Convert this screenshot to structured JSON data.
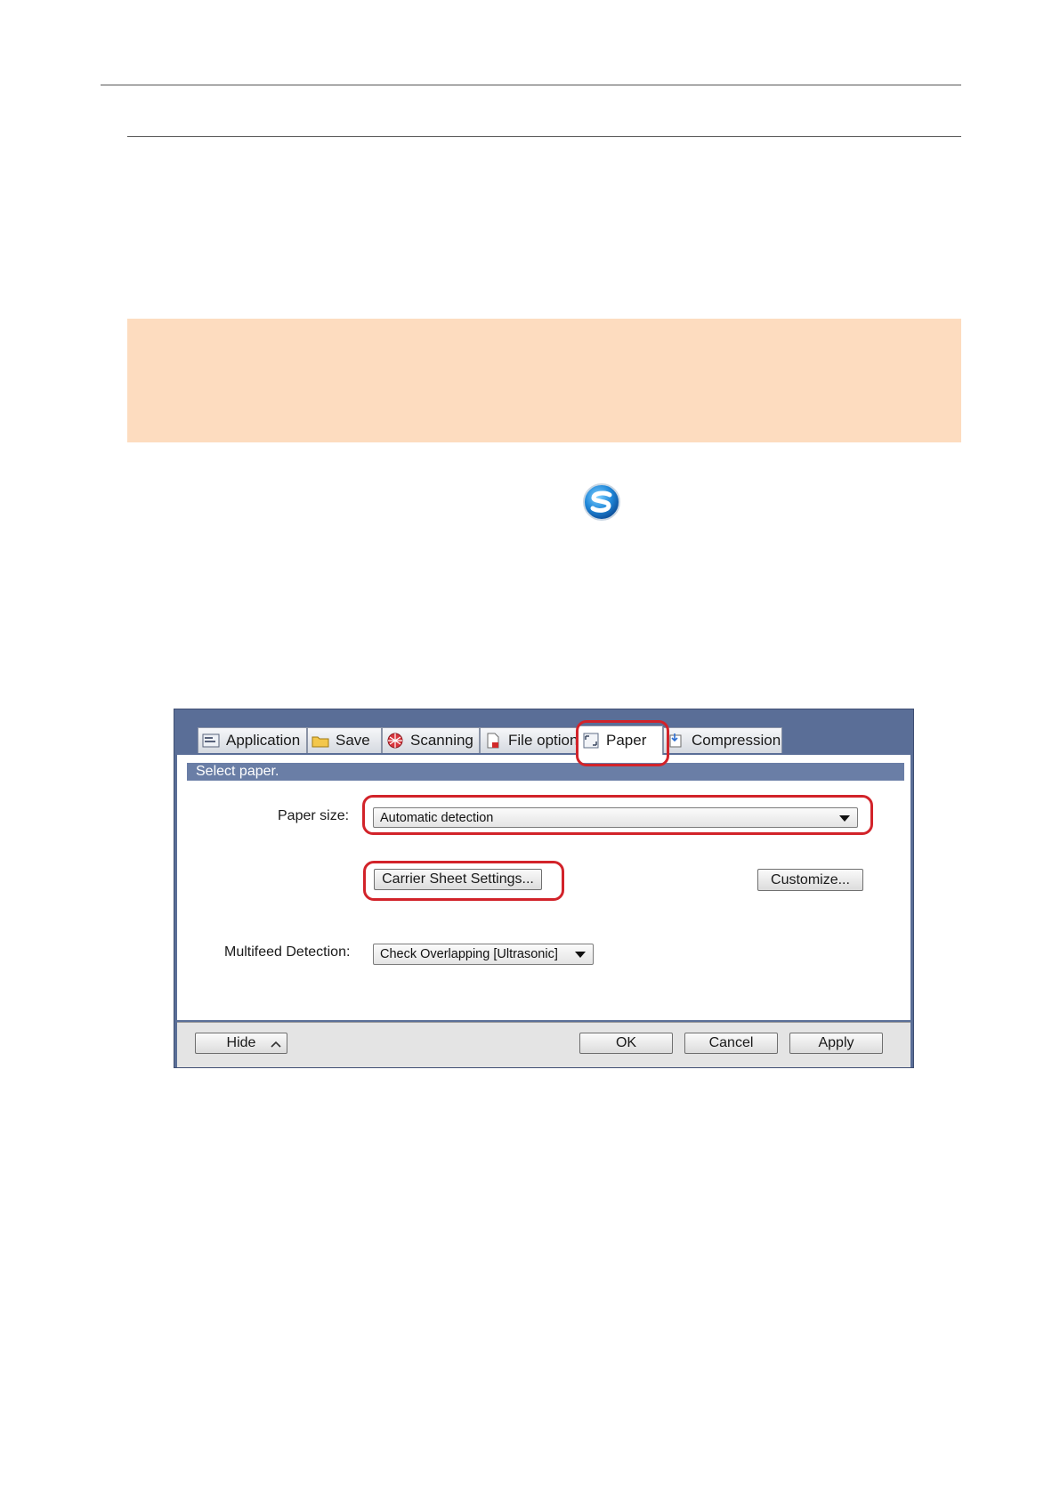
{
  "dialog": {
    "tabs": [
      {
        "label": "Application",
        "icon": "application-icon"
      },
      {
        "label": "Save",
        "icon": "folder-icon"
      },
      {
        "label": "Scanning",
        "icon": "scanning-icon"
      },
      {
        "label": "File option",
        "icon": "file-option-icon"
      },
      {
        "label": "Paper",
        "icon": "paper-icon",
        "active": true
      },
      {
        "label": "Compression",
        "icon": "compression-icon"
      }
    ],
    "section_title": "Select paper.",
    "paper_size_label": "Paper size:",
    "paper_size_value": "Automatic detection",
    "carrier_button": "Carrier Sheet Settings...",
    "customize_button": "Customize...",
    "multifeed_label": "Multifeed Detection:",
    "multifeed_value": "Check Overlapping [Ultrasonic]",
    "hide_button": "Hide",
    "ok_button": "OK",
    "cancel_button": "Cancel",
    "apply_button": "Apply"
  },
  "colors": {
    "note_background": "#fddcbf",
    "highlight": "#d2232a",
    "dialog_frame": "#5a6e97"
  }
}
